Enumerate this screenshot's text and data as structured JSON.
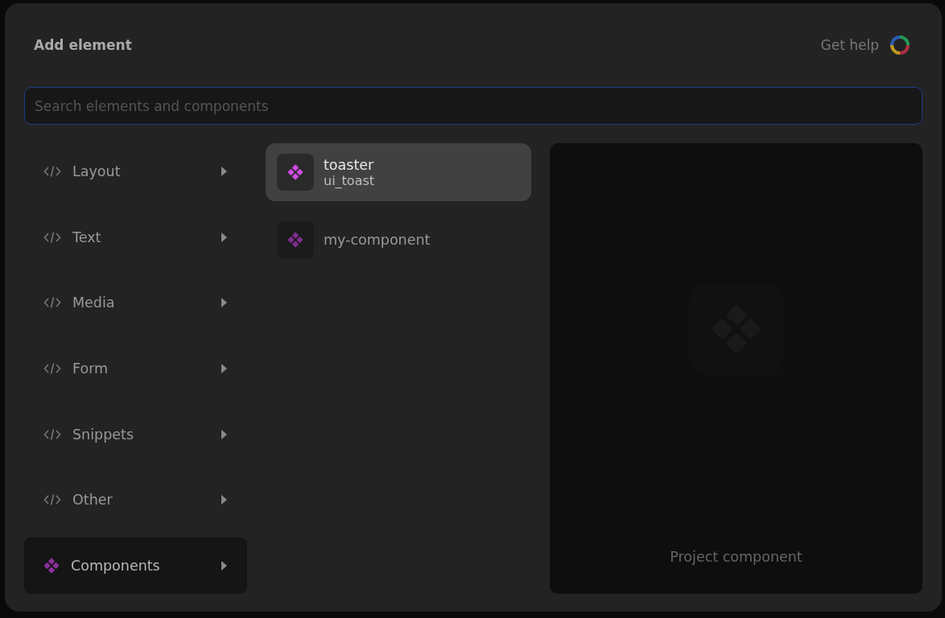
{
  "dialog": {
    "title": "Add element",
    "help_link": "Get help"
  },
  "search": {
    "placeholder": "Search elements and components"
  },
  "categories": [
    {
      "label": "Layout",
      "kind": "code",
      "selected": false
    },
    {
      "label": "Text",
      "kind": "code",
      "selected": false
    },
    {
      "label": "Media",
      "kind": "code",
      "selected": false
    },
    {
      "label": "Form",
      "kind": "code",
      "selected": false
    },
    {
      "label": "Snippets",
      "kind": "code",
      "selected": false
    },
    {
      "label": "Other",
      "kind": "code",
      "selected": false
    },
    {
      "label": "Components",
      "kind": "component",
      "selected": true
    }
  ],
  "components": [
    {
      "name": "toaster",
      "subtitle": "ui_toast",
      "selected": true
    },
    {
      "name": "my-component",
      "selected": false
    }
  ],
  "preview": {
    "caption": "Project component"
  }
}
